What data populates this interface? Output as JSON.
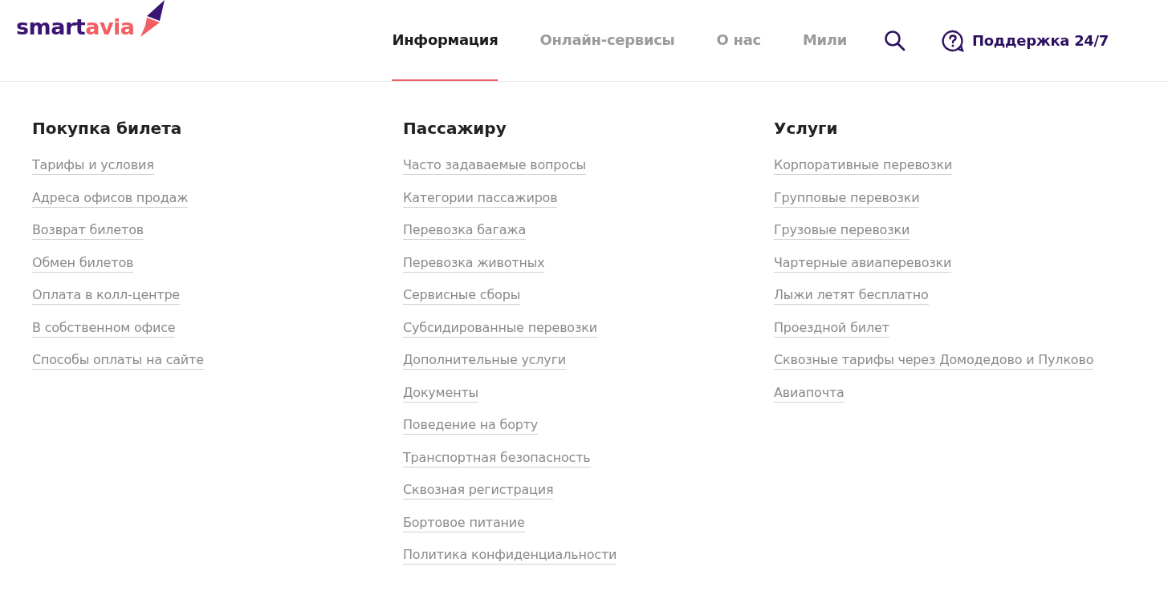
{
  "logo": {
    "dark_part": "smart",
    "accent_part": "avia"
  },
  "nav": [
    {
      "label": "Информация",
      "selected": true
    },
    {
      "label": "Онлайн-сервисы",
      "selected": false
    },
    {
      "label": "О нас",
      "selected": false
    },
    {
      "label": "Мили",
      "selected": false
    }
  ],
  "support": {
    "label": "Поддержка 24/7"
  },
  "columns": [
    {
      "title": "Покупка билета",
      "links": [
        "Тарифы и условия",
        "Адреса офисов продаж",
        "Возврат билетов",
        "Обмен билетов",
        "Оплата в колл-центре",
        "В собственном офисе",
        "Способы оплаты на сайте"
      ]
    },
    {
      "title": "Пассажиру",
      "links": [
        "Часто задаваемые вопросы",
        "Категории пассажиров",
        "Перевозка багажа",
        "Перевозка животных",
        "Сервисные сборы",
        "Субсидированные перевозки",
        "Дополнительные услуги",
        "Документы",
        "Поведение на борту",
        "Транспортная безопасность",
        "Сквозная регистрация",
        "Бортовое питание",
        "Политика конфиденциальности"
      ]
    },
    {
      "title": "Услуги",
      "links": [
        "Корпоративные перевозки",
        "Групповые перевозки",
        "Грузовые перевозки",
        "Чартерные авиаперевозки",
        "Лыжи летят бесплатно",
        "Проездной билет",
        "Сквозные тарифы через Домодедово и Пулково",
        "Авиапочта"
      ]
    }
  ]
}
